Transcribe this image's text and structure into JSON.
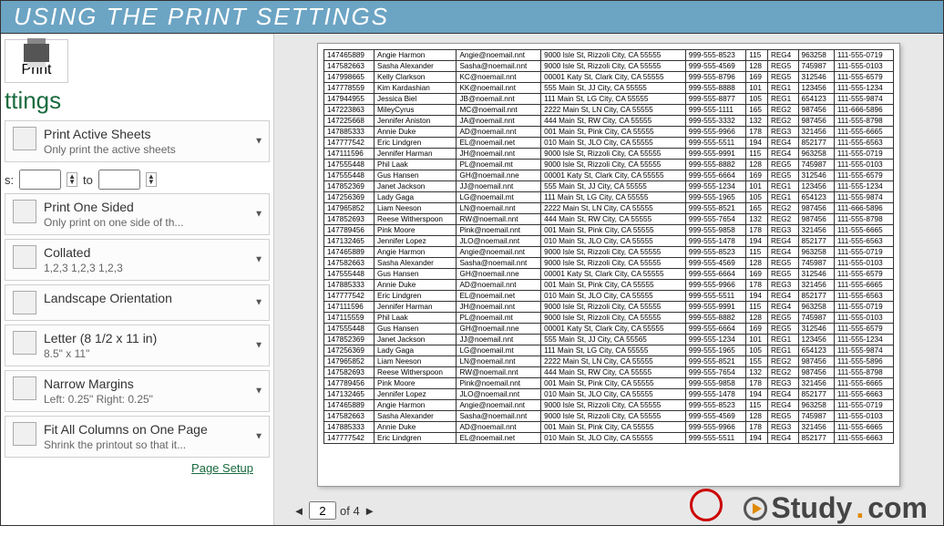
{
  "titlebar": "USING THE PRINT SETTINGS",
  "printLabel": "Print",
  "settingsPartial": "ttings",
  "pageRange": {
    "label": "s:",
    "to": "to"
  },
  "options": [
    {
      "t1": "Print Active Sheets",
      "t2": "Only print the active sheets"
    },
    {
      "t1": "Print One Sided",
      "t2": "Only print on one side of th..."
    },
    {
      "t1": "Collated",
      "t2": "1,2,3    1,2,3    1,2,3"
    },
    {
      "t1": "Landscape Orientation",
      "t2": ""
    },
    {
      "t1": "Letter (8 1/2 x 11 in)",
      "t2": "8.5\" x 11\""
    },
    {
      "t1": "Narrow Margins",
      "t2": "Left:  0.25\"    Right:  0.25\""
    },
    {
      "t1": "Fit All Columns on One Page",
      "t2": "Shrink the printout so that it..."
    }
  ],
  "pageSetup": "Page Setup",
  "pager": {
    "current": "2",
    "of": "of 4"
  },
  "watermark": {
    "brand": "Study",
    "dot": ".",
    "com": "com"
  },
  "rows": [
    [
      "147465889",
      "Angie Harmon",
      "Angie@noemail.nnt",
      "9000 Isle St, Rizzoli City, CA 55555",
      "999-555-8523",
      "115",
      "REG4",
      "963258",
      "111-555-0719"
    ],
    [
      "147582663",
      "Sasha Alexander",
      "Sasha@noemail.nnt",
      "9000 Isle St, Rizzoli City, CA 55555",
      "999-555-4569",
      "128",
      "REG5",
      "745987",
      "111-555-0103"
    ],
    [
      "147998665",
      "Kelly Clarkson",
      "KC@noemail.nnt",
      "00001 Katy St, Clark City, CA 55555",
      "999-555-8796",
      "169",
      "REG5",
      "312546",
      "111-555-6579"
    ],
    [
      "147778559",
      "Kim Kardashian",
      "KK@noemail.nnt",
      "555 Main St, JJ City, CA 55555",
      "999-555-8888",
      "101",
      "REG1",
      "123456",
      "111-555-1234"
    ],
    [
      "147944955",
      "Jessica Biel",
      "JB@noemail.nnt",
      "111 Main St, LG City, CA 55555",
      "999-555-8877",
      "105",
      "REG1",
      "654123",
      "111-555-9874"
    ],
    [
      "147223863",
      "MileyCyrus",
      "MC@noemail.nnt",
      "2222 Main St, LN City, CA 55555",
      "999-555-1111",
      "165",
      "REG2",
      "987456",
      "111-666-5896"
    ],
    [
      "147225668",
      "Jennifer Aniston",
      "JA@noemail.nnt",
      "444 Main St, RW City, CA 55555",
      "999-555-3332",
      "132",
      "REG2",
      "987456",
      "111-555-8798"
    ],
    [
      "147885333",
      "Annie Duke",
      "AD@noemail.nnt",
      "001 Main St, Pink City, CA 55555",
      "999-555-9966",
      "178",
      "REG3",
      "321456",
      "111-555-6665"
    ],
    [
      "147777542",
      "Eric Lindgren",
      "EL@noemail.net",
      "010 Main St, JLO City, CA 55555",
      "999-555-5511",
      "194",
      "REG4",
      "852177",
      "111-555-6563"
    ],
    [
      "147111596",
      "Jennifer Harman",
      "JH@noemail.nnt",
      "9000 Isle St, Rizzoli City, CA 55555",
      "999-555-9991",
      "115",
      "REG4",
      "963258",
      "111-555-0719"
    ],
    [
      "147555448",
      "Phil Laak",
      "PL@noemail.mt",
      "9000 Isle St, Rizzoli City, CA 55555",
      "999-555-8882",
      "128",
      "REG5",
      "745987",
      "111-555-0103"
    ],
    [
      "147555448",
      "Gus Hansen",
      "GH@noemail.nne",
      "00001 Katy St, Clark City, CA 55555",
      "999-555-6664",
      "169",
      "REG5",
      "312546",
      "111-555-6579"
    ],
    [
      "147852369",
      "Janet Jackson",
      "JJ@noemail.nnt",
      "555 Main St, JJ City, CA 55555",
      "999-555-1234",
      "101",
      "REG1",
      "123456",
      "111-555-1234"
    ],
    [
      "147256369",
      "Lady Gaga",
      "LG@noemail.mt",
      "111 Main St, LG City, CA 55555",
      "999-555-1965",
      "105",
      "REG1",
      "654123",
      "111-555-9874"
    ],
    [
      "147965852",
      "Liam Neeson",
      "LN@noemail.nnt",
      "2222 Main St, LN City, CA 55555",
      "999-555-8521",
      "165",
      "REG2",
      "987456",
      "111-666-5896"
    ],
    [
      "147852693",
      "Reese Witherspoon",
      "RW@noemail.nnt",
      "444 Main St, RW City, CA 55555",
      "999-555-7654",
      "132",
      "REG2",
      "987456",
      "111-555-8798"
    ],
    [
      "147789456",
      "Pink Moore",
      "Pink@noemail.nnt",
      "001 Main St, Pink City, CA 55555",
      "999-555-9858",
      "178",
      "REG3",
      "321456",
      "111-555-6665"
    ],
    [
      "147132465",
      "Jennifer Lopez",
      "JLO@noemail.nnt",
      "010 Main St, JLO City, CA 55555",
      "999-555-1478",
      "194",
      "REG4",
      "852177",
      "111-555-6563"
    ],
    [
      "147465889",
      "Angie Harmon",
      "Angie@noemail.nnt",
      "9000 Isle St, Rizzoli City, CA 55555",
      "999-555-8523",
      "115",
      "REG4",
      "963258",
      "111-555-0719"
    ],
    [
      "147582663",
      "Sasha Alexander",
      "Sasha@noemail.nnt",
      "9000 Isle St, Rizzoli City, CA 55555",
      "999-555-4569",
      "128",
      "REG5",
      "745987",
      "111-555-0103"
    ],
    [
      "147555448",
      "Gus Hansen",
      "GH@noemail.nne",
      "00001 Katy St, Clark City, CA 55555",
      "999-555-6664",
      "169",
      "REG5",
      "312546",
      "111-555-6579"
    ],
    [
      "147885333",
      "Annie Duke",
      "AD@noemail.nnt",
      "001 Main St, Pink City, CA 55555",
      "999-555-9966",
      "178",
      "REG3",
      "321456",
      "111-555-6665"
    ],
    [
      "147777542",
      "Eric Lindgren",
      "EL@noemail.net",
      "010 Main St, JLO City, CA 55555",
      "999-555-5511",
      "194",
      "REG4",
      "852177",
      "111-555-6563"
    ],
    [
      "147111596",
      "Jennifer Harman",
      "JH@noemail.nnt",
      "9000 Isle St, Rizzoli City, CA 55555",
      "999-555-9991",
      "115",
      "REG4",
      "963258",
      "111-555-0719"
    ],
    [
      "147115559",
      "Phil Laak",
      "PL@noemail.mt",
      "9000 Isle St, Rizzoli City, CA 55555",
      "999-555-8882",
      "128",
      "REG5",
      "745987",
      "111-555-0103"
    ],
    [
      "147555448",
      "Gus Hansen",
      "GH@noemail.nne",
      "00001 Katy St, Clark City, CA 55555",
      "999-555-6664",
      "169",
      "REG5",
      "312546",
      "111-555-6579"
    ],
    [
      "147852369",
      "Janet Jackson",
      "JJ@noemail.nnt",
      "555 Main St, JJ City, CA 55565",
      "999-555-1234",
      "101",
      "REG1",
      "123456",
      "111-555-1234"
    ],
    [
      "147256369",
      "Lady Gaga",
      "LG@noemail.mt",
      "111 Main St, LG City, CA 55555",
      "999-555-1965",
      "105",
      "REG1",
      "654123",
      "111-555-9874"
    ],
    [
      "147965852",
      "Liam Neeson",
      "LN@noemail.nnt",
      "2222 Main St, LN City, CA 55555",
      "999-555-8521",
      "155",
      "REG2",
      "987456",
      "111-555-5896"
    ],
    [
      "147582693",
      "Reese Witherspoon",
      "RW@noemail.nnt",
      "444 Main St, RW City, CA 55555",
      "999-555-7654",
      "132",
      "REG2",
      "987456",
      "111-555-8798"
    ],
    [
      "147789456",
      "Pink Moore",
      "Pink@noemail.nnt",
      "001 Main St, Pink City, CA 55555",
      "999-555-9858",
      "178",
      "REG3",
      "321456",
      "111-555-6665"
    ],
    [
      "147132465",
      "Jennifer Lopez",
      "JLO@noemail.nnt",
      "010 Main St, JLO City, CA 55555",
      "999-555-1478",
      "194",
      "REG4",
      "852177",
      "111-555-6663"
    ],
    [
      "147465889",
      "Angie Harmon",
      "Angie@noemail.nnt",
      "9000 Isle St, Rizzoli City, CA 55555",
      "999-555-8523",
      "115",
      "REG4",
      "963258",
      "111-555-0719"
    ],
    [
      "147582663",
      "Sasha Alexander",
      "Sasha@noemail.nnt",
      "9000 Isle St, Rizzoli City, CA 55555",
      "999-555-4569",
      "128",
      "REG5",
      "745987",
      "111-555-0103"
    ],
    [
      "147885333",
      "Annie Duke",
      "AD@noemail.nnt",
      "001 Main St, Pink City, CA 55555",
      "999-555-9966",
      "178",
      "REG3",
      "321456",
      "111-555-6665"
    ],
    [
      "147777542",
      "Eric Lindgren",
      "EL@noemail.net",
      "010 Main St, JLO City, CA 55555",
      "999-555-5511",
      "194",
      "REG4",
      "852177",
      "111-555-6663"
    ]
  ]
}
